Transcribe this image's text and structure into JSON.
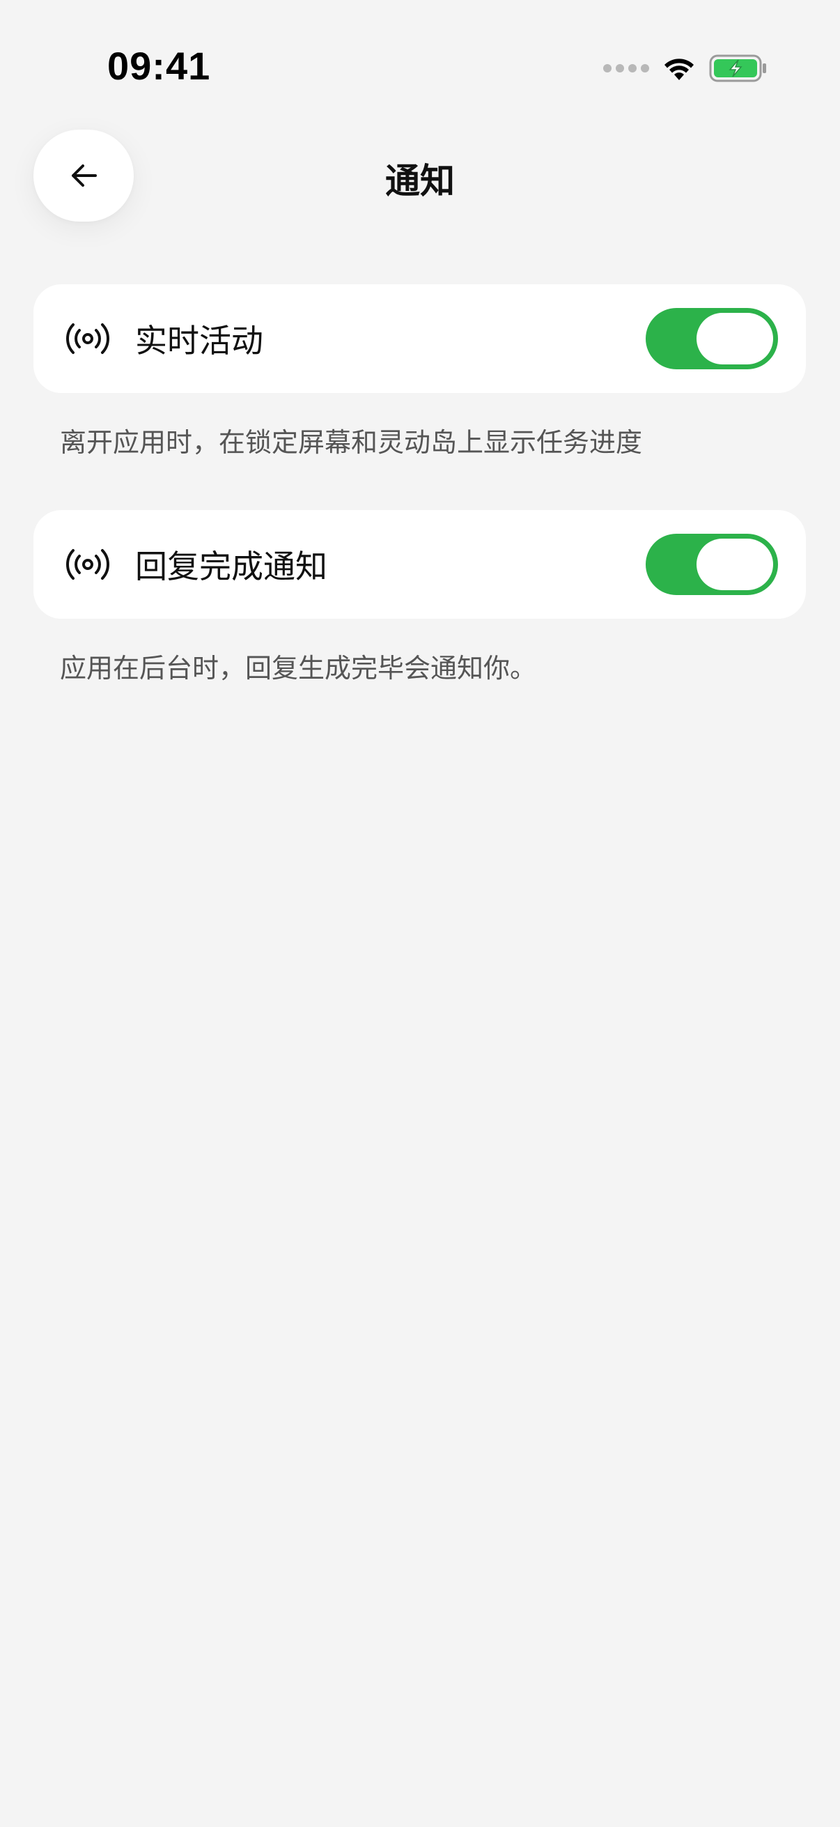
{
  "status_bar": {
    "time": "09:41",
    "icons": [
      "signal-dots-icon",
      "wifi-icon",
      "battery-charging-icon"
    ],
    "battery_color": "#34c759"
  },
  "header": {
    "title": "通知",
    "back_icon": "arrow-left-icon"
  },
  "settings": [
    {
      "label": "实时活动",
      "icon": "broadcast-icon",
      "enabled": true,
      "description": "离开应用时，在锁定屏幕和灵动岛上显示任务进度"
    },
    {
      "label": "回复完成通知",
      "icon": "broadcast-icon",
      "enabled": true,
      "description": "应用在后台时，回复生成完毕会通知你。"
    }
  ],
  "colors": {
    "background": "#f4f4f4",
    "card": "#ffffff",
    "toggle_on": "#2cb24a",
    "text_primary": "#111111",
    "text_secondary": "#555555"
  }
}
